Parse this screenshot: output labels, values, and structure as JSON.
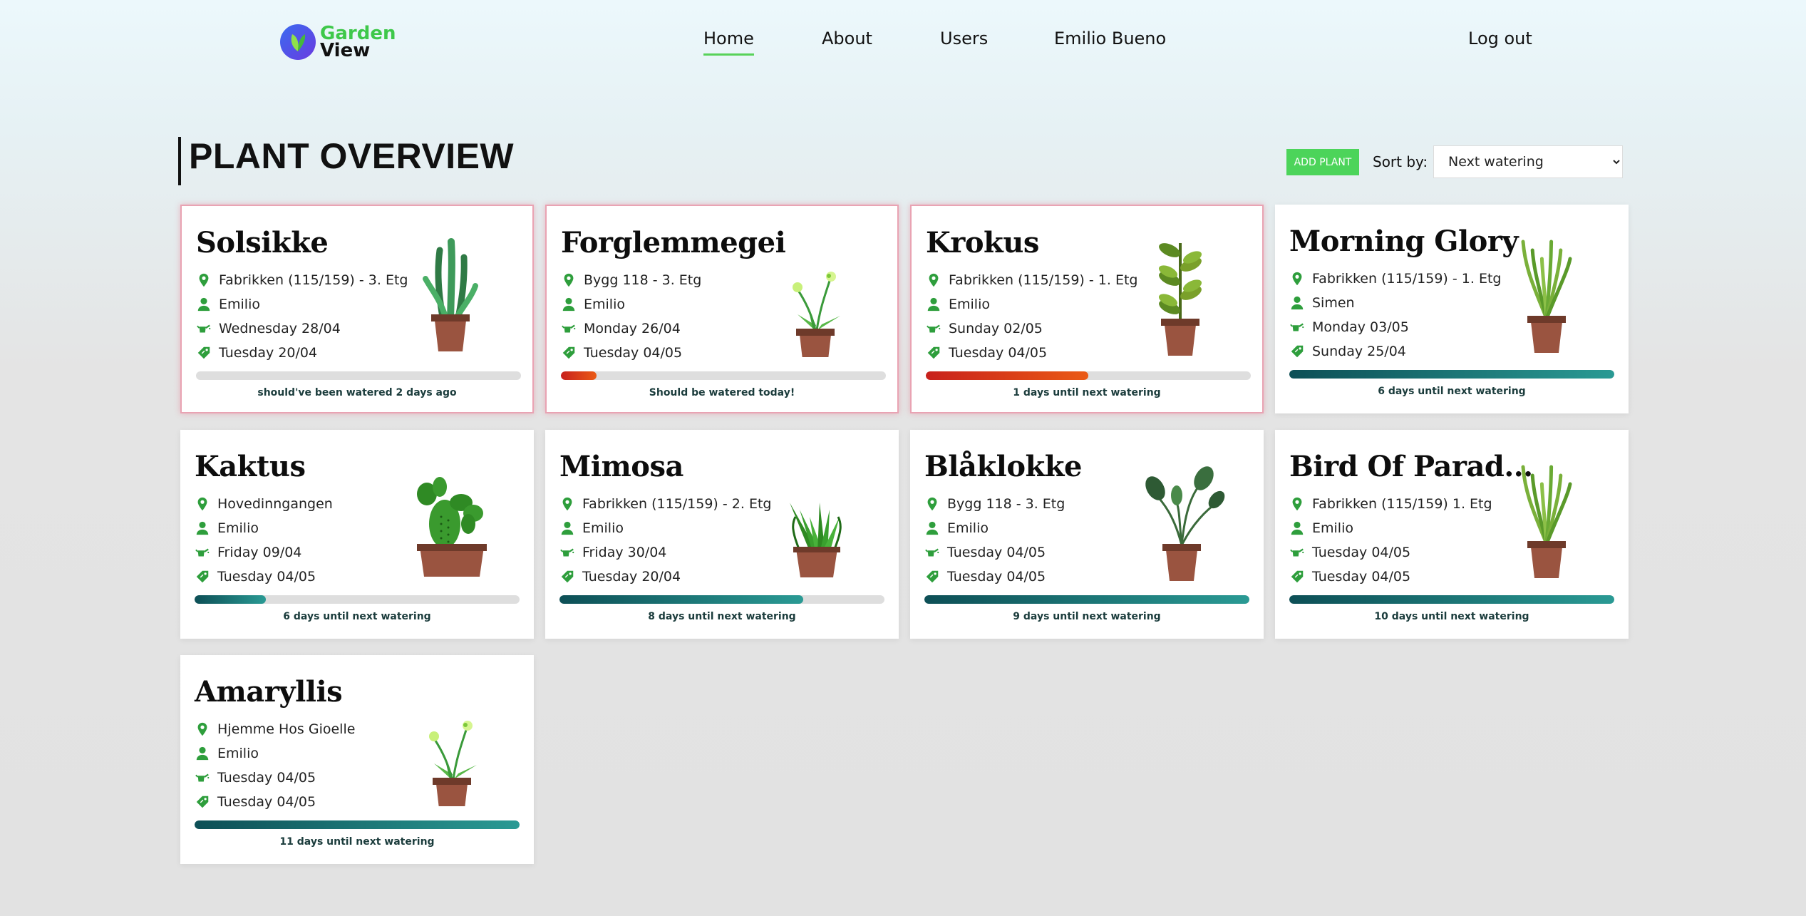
{
  "nav": {
    "logo_line1": "Garden",
    "logo_line2": "View",
    "links": [
      "Home",
      "About",
      "Users",
      "Emilio Bueno"
    ],
    "logout": "Log out"
  },
  "header": {
    "title": "PLANT OVERVIEW",
    "add_button": "ADD PLANT",
    "sort_label": "Sort by:",
    "sort_value": "Next watering"
  },
  "colors": {
    "accent_green": "#4cd45a",
    "alert_border": "#e9a3b3",
    "progress_red": "#c8211c",
    "progress_teal": "#0d4f56"
  },
  "cards": [
    {
      "name": "Solsikke",
      "location": "Fabrikken (115/159) - 3. Etg",
      "owner": "Emilio",
      "watered": "Wednesday 28/04",
      "fertilized": "Tuesday 20/04",
      "progress": 0,
      "status": "should've been watered 2 days ago",
      "alert": true,
      "plant_icon": "snake-plant-icon"
    },
    {
      "name": "Forglemmegei",
      "location": "Bygg 118 - 3. Etg",
      "owner": "Emilio",
      "watered": "Monday 26/04",
      "fertilized": "Tuesday 04/05",
      "progress": 0.11,
      "status": "Should be watered today!",
      "alert": true,
      "plant_icon": "flower-plant-icon"
    },
    {
      "name": "Krokus",
      "location": "Fabrikken (115/159) - 1. Etg",
      "owner": "Emilio",
      "watered": "Sunday 02/05",
      "fertilized": "Tuesday 04/05",
      "progress": 0.5,
      "status": "1 days until next watering",
      "alert": true,
      "plant_icon": "tall-leaf-plant-icon"
    },
    {
      "name": "Morning Glory",
      "location": "Fabrikken (115/159) - 1. Etg",
      "owner": "Simen",
      "watered": "Monday 03/05",
      "fertilized": "Sunday 25/04",
      "progress": 1,
      "status": "6 days until next watering",
      "alert": false,
      "plant_icon": "grass-plant-icon"
    },
    {
      "name": "Kaktus",
      "location": "Hovedinngangen",
      "owner": "Emilio",
      "watered": "Friday 09/04",
      "fertilized": "Tuesday 04/05",
      "progress": 0.22,
      "status": "6 days until next watering",
      "alert": false,
      "plant_icon": "cactus-icon"
    },
    {
      "name": "Mimosa",
      "location": "Fabrikken (115/159) - 2. Etg",
      "owner": "Emilio",
      "watered": "Friday 30/04",
      "fertilized": "Tuesday 20/04",
      "progress": 0.75,
      "status": "8 days until next watering",
      "alert": false,
      "plant_icon": "aloe-plant-icon"
    },
    {
      "name": "Blåklokke",
      "location": "Bygg 118 - 3. Etg",
      "owner": "Emilio",
      "watered": "Tuesday 04/05",
      "fertilized": "Tuesday 04/05",
      "progress": 1,
      "status": "9 days until next watering",
      "alert": false,
      "plant_icon": "broad-leaf-plant-icon"
    },
    {
      "name": "Bird Of Parad...",
      "location": "Fabrikken (115/159) 1. Etg",
      "owner": "Emilio",
      "watered": "Tuesday 04/05",
      "fertilized": "Tuesday 04/05",
      "progress": 1,
      "status": "10 days until next watering",
      "alert": false,
      "plant_icon": "grass-plant-icon"
    },
    {
      "name": "Amaryllis",
      "location": "Hjemme Hos Gioelle",
      "owner": "Emilio",
      "watered": "Tuesday 04/05",
      "fertilized": "Tuesday 04/05",
      "progress": 1,
      "status": "11 days until next watering",
      "alert": false,
      "plant_icon": "flower-plant-icon"
    }
  ]
}
